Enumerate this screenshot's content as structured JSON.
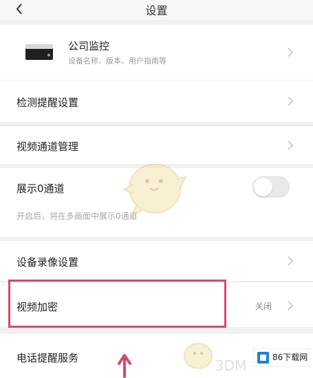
{
  "header": {
    "title": "设置",
    "back_icon": "chevron-left-icon"
  },
  "device": {
    "name": "公司监控",
    "subtitle": "设备名称、版本、用户指南等"
  },
  "rows": {
    "detect_reminder": "检测提醒设置",
    "channel_manage": "视频通道管理",
    "show_channel0": "展示0通道",
    "show_channel0_hint": "开启后，将在多画面中展示0通道",
    "record_settings": "设备录像设置",
    "video_encrypt": "视频加密",
    "video_encrypt_value": "关闭",
    "phone_reminder": "电话提醒服务"
  },
  "toggle": {
    "show_channel0_on": false
  },
  "watermarks": {
    "site_text": "3DM",
    "badge_text": "86下载网"
  },
  "colors": {
    "background": "#f1f1f1",
    "card": "#ffffff",
    "highlight": "#d7486b",
    "accent_blue": "#1e7fe0"
  }
}
